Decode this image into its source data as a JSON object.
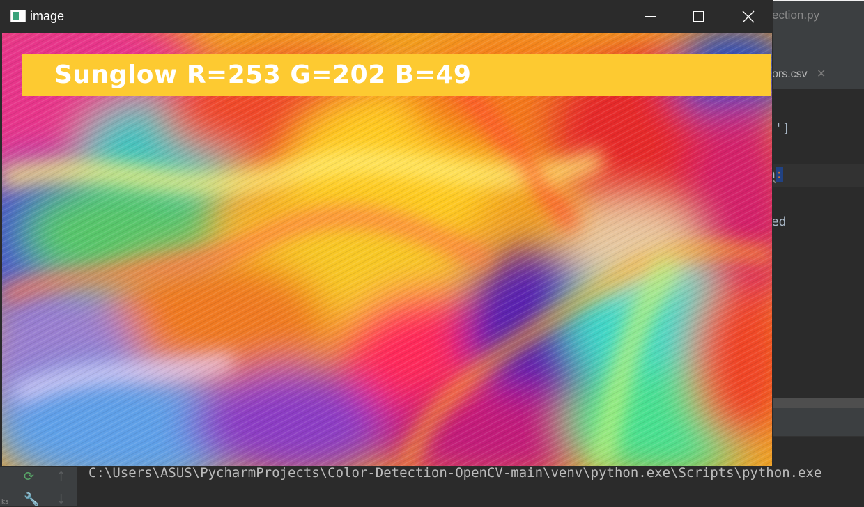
{
  "ide": {
    "file_tab_py": "ection.py",
    "file_tab_csv": "ors.csv",
    "tab_close": "✕",
    "code_line_1": "']",
    "code_line_2_word": "n",
    "code_line_2_colon": ":",
    "code_line_3": "xed",
    "side_label": "ks",
    "console_line": "C:\\Users\\ASUS\\PycharmProjects\\Color-Detection-OpenCV-main\\venv\\python.exe\\Scripts\\python.exe"
  },
  "window": {
    "title": "image",
    "minimize_icon": "minimize-icon",
    "maximize_icon": "maximize-icon",
    "close_icon": "close-icon"
  },
  "detection": {
    "banner_text": "Sunglow R=253 G=202 B=49",
    "color_name": "Sunglow",
    "rgb": [
      253,
      202,
      49
    ],
    "banner_color": "#fdca31"
  }
}
